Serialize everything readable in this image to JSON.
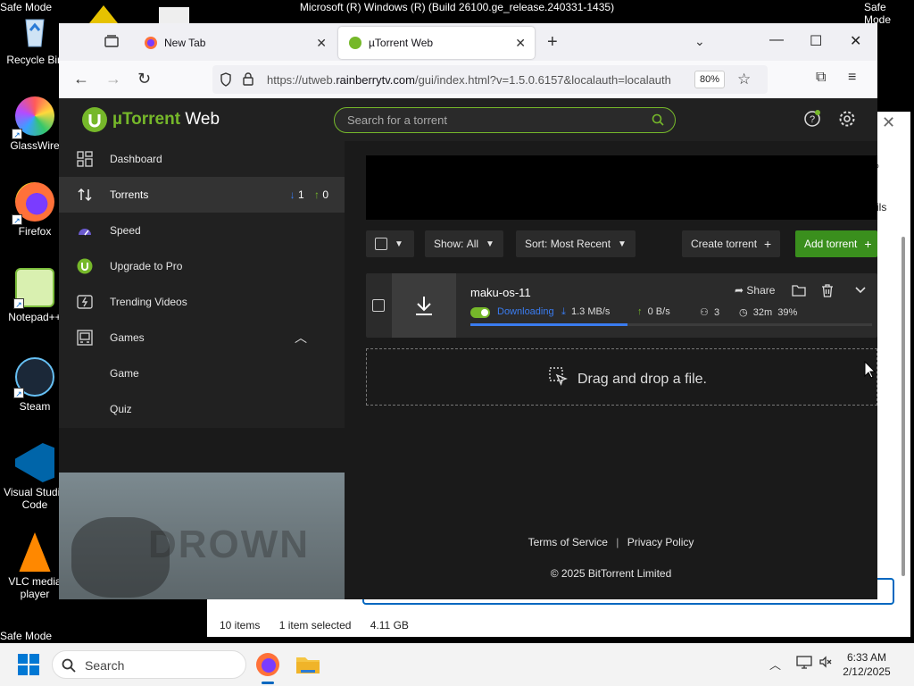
{
  "desktop": {
    "safe_mode_label": "Safe Mode",
    "title_text": "Microsoft (R) Windows (R) (Build 26100.ge_release.240331-1435)",
    "icons": [
      {
        "label": "Recycle Bin",
        "icon": "recycle-bin-icon"
      },
      {
        "label": "GlassWire",
        "icon": "glasswire-icon"
      },
      {
        "label": "Firefox",
        "icon": "firefox-icon"
      },
      {
        "label": "Notepad++",
        "icon": "notepadpp-icon"
      },
      {
        "label": "Steam",
        "icon": "steam-icon"
      },
      {
        "label": "Visual Studio Code",
        "icon": "vscode-icon"
      },
      {
        "label": "VLC media player",
        "icon": "vlc-icon"
      }
    ]
  },
  "explorer": {
    "side_text": "ils",
    "status_items": "10 items",
    "status_selected": "1 item selected",
    "status_size": "4.11 GB"
  },
  "browser": {
    "tabs": [
      {
        "label": "New Tab"
      },
      {
        "label": "µTorrent Web"
      }
    ],
    "url": "https://utweb.",
    "url_domain": "rainberrytv.com",
    "url_rest": "/gui/index.html?v=1.5.0.6157&localauth=localauth",
    "zoom": "80%"
  },
  "app": {
    "brand_mu": "µTorrent",
    "brand_rest": " Web",
    "search_placeholder": "Search for a torrent",
    "sidebar": [
      {
        "label": "Dashboard"
      },
      {
        "label": "Torrents",
        "down_count": "1",
        "up_count": "0"
      },
      {
        "label": "Speed"
      },
      {
        "label": "Upgrade to Pro"
      },
      {
        "label": "Trending Videos"
      },
      {
        "label": "Games"
      },
      {
        "label": "Game"
      },
      {
        "label": "Quiz"
      }
    ],
    "video_overlay_text": "DROWN",
    "toolbar": {
      "show_label": "Show:",
      "show_value": "All",
      "sort_label": "Sort:",
      "sort_value": "Most Recent",
      "create_label": "Create torrent",
      "add_label": "Add torrent"
    },
    "torrent": {
      "name": "maku-os-11",
      "status": "Downloading",
      "down_speed": "1.3 MB/s",
      "up_speed": "0 B/s",
      "peers": "3",
      "eta": "32m",
      "percent": "39%",
      "progress": 0.39,
      "share_label": "Share"
    },
    "dropzone_text": "Drag and drop a file.",
    "footer": {
      "terms": "Terms of Service",
      "privacy": "Privacy Policy",
      "copyright": "© 2025 BitTorrent Limited"
    },
    "colors": {
      "accent_green": "#76b82a",
      "accent_blue": "#3a7cf0"
    }
  },
  "taskbar": {
    "search_placeholder": "Search",
    "time": "6:33 AM",
    "date": "2/12/2025"
  }
}
